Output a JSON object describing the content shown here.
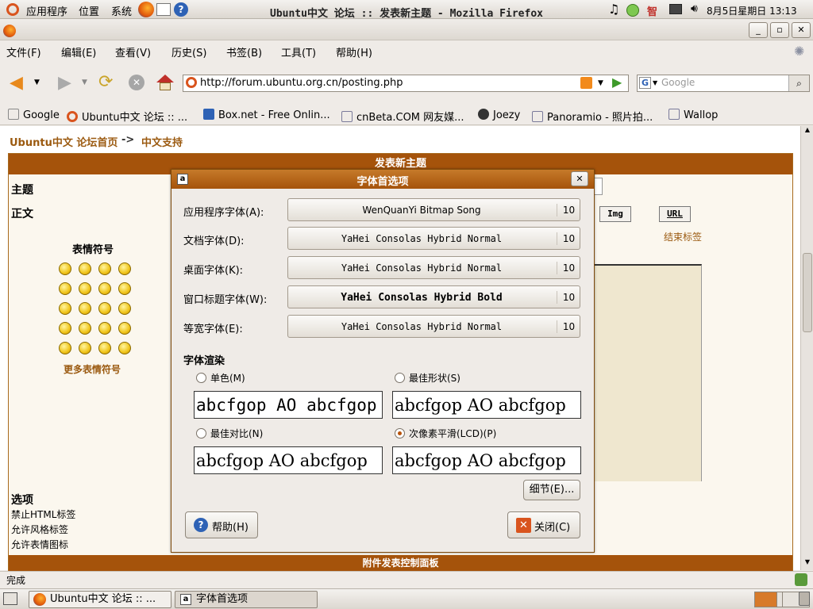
{
  "top_panel": {
    "menus": [
      "应用程序",
      "位置",
      "系统"
    ],
    "clock": "8月5日星期日 13:13",
    "ime": "智"
  },
  "browser": {
    "title": "Ubuntu中文 论坛 :: 发表新主题 - Mozilla Firefox",
    "menus": [
      "文件(F)",
      "编辑(E)",
      "查看(V)",
      "历史(S)",
      "书签(B)",
      "工具(T)",
      "帮助(H)"
    ],
    "url": "http://forum.ubuntu.org.cn/posting.php",
    "search_placeholder": "Google",
    "bookmarks": [
      "Google",
      "Ubuntu中文 论坛 :: ...",
      "Box.net - Free Onlin...",
      "cnBeta.COM 网友媒...",
      "Joezy",
      "Panoramio - 照片拍...",
      "Wallop"
    ],
    "status": "完成"
  },
  "page": {
    "breadcrumb": [
      "Ubuntu中文 论坛首页",
      "->",
      "中文支持"
    ],
    "header": "发表新主题",
    "subject_label": "主题",
    "body_label": "正文",
    "emoticons_label": "表情符号",
    "more_emoticons": "更多表情符号",
    "tag_buttons": [
      "Img",
      "URL"
    ],
    "close_tags": "结束标签",
    "options_label": "选项",
    "options": [
      "禁止HTML标签",
      "允许风格标签",
      "允许表情图标"
    ],
    "footer_header": "附件发表控制面板"
  },
  "dialog": {
    "title": "字体首选项",
    "fonts": [
      {
        "label": "应用程序字体(A):",
        "name": "WenQuanYi Bitmap Song",
        "size": "10"
      },
      {
        "label": "文档字体(D):",
        "name": "YaHei Consolas Hybrid Normal",
        "size": "10"
      },
      {
        "label": "桌面字体(K):",
        "name": "YaHei Consolas Hybrid Normal",
        "size": "10"
      },
      {
        "label": "窗口标题字体(W):",
        "name": "YaHei Consolas Hybrid Bold",
        "size": "10"
      },
      {
        "label": "等宽字体(E):",
        "name": "YaHei Consolas Hybrid Normal",
        "size": "10"
      }
    ],
    "rendering_label": "字体渲染",
    "rendering_options": [
      {
        "label": "单色(M)",
        "selected": false
      },
      {
        "label": "最佳形状(S)",
        "selected": false
      },
      {
        "label": "最佳对比(N)",
        "selected": false
      },
      {
        "label": "次像素平滑(LCD)(P)",
        "selected": true
      }
    ],
    "preview_text": "abcfgop AO abcfgop",
    "details_button": "细节(E)...",
    "help_button": "帮助(H)",
    "close_button": "关闭(C)"
  },
  "taskbar": {
    "tasks": [
      "Ubuntu中文 论坛 :: ...",
      "字体首选项"
    ]
  },
  "colors": {
    "accent": "#a5530b",
    "dialog_title": "#b86414"
  }
}
